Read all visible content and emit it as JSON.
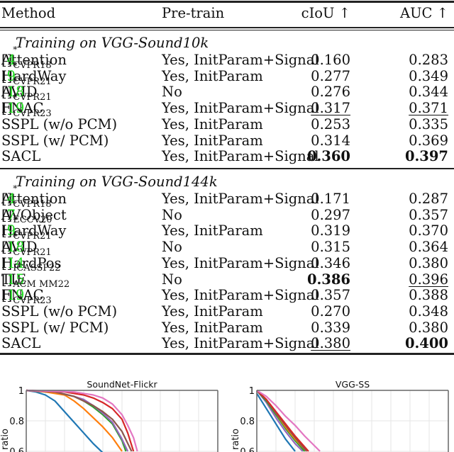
{
  "table": {
    "headers": {
      "method": "Method",
      "pretrain": "Pre-train",
      "ciou": "cIoU ↑",
      "auc": "AUC ↑"
    },
    "sections": [
      {
        "title": "Training on VGG-Sound10k",
        "rows": [
          {
            "name": "Attention",
            "ref": "4",
            "star": "*",
            "venue": "CVPR18",
            "pretrain": "Yes, InitParam+Signal",
            "ciou": "0.160",
            "auc": "0.283",
            "ciou_style": "",
            "auc_style": ""
          },
          {
            "name": "HardWay",
            "ref": "9",
            "star": "*",
            "venue": "CVPR21",
            "pretrain": "Yes, InitParam",
            "ciou": "0.277",
            "auc": "0.349",
            "ciou_style": "",
            "auc_style": ""
          },
          {
            "name": "AVID",
            "ref": "18",
            "star": "*",
            "venue": "CVPR21",
            "pretrain": "No",
            "ciou": "0.276",
            "auc": "0.344",
            "ciou_style": "",
            "auc_style": ""
          },
          {
            "name": "FNAC",
            "ref": "19",
            "star": "*",
            "venue": "CVPR23",
            "pretrain": "Yes, InitParam+Signal",
            "ciou": "0.317",
            "auc": "0.371",
            "ciou_style": "underline",
            "auc_style": "underline"
          },
          {
            "name": "SSPL (w/o PCM)",
            "ref": "",
            "star": "",
            "venue": "",
            "pretrain": "Yes, InitParam",
            "ciou": "0.253",
            "auc": "0.335",
            "ciou_style": "",
            "auc_style": ""
          },
          {
            "name": "SSPL (w/ PCM)",
            "ref": "",
            "star": "",
            "venue": "",
            "pretrain": "Yes, InitParam",
            "ciou": "0.314",
            "auc": "0.369",
            "ciou_style": "",
            "auc_style": ""
          },
          {
            "name": "SACL",
            "ref": "",
            "star": "",
            "venue": "",
            "pretrain": "Yes, InitParam+Signal",
            "ciou": "0.360",
            "auc": "0.397",
            "ciou_style": "bold",
            "auc_style": "bold"
          }
        ]
      },
      {
        "title": "Training on VGG-Sound144k",
        "rows": [
          {
            "name": "Attention",
            "ref": "4",
            "star": "*",
            "venue": "CVPR18",
            "pretrain": "Yes, InitParam+Signal",
            "ciou": "0.171",
            "auc": "0.287",
            "ciou_style": "",
            "auc_style": ""
          },
          {
            "name": "AVObject",
            "ref": "7",
            "star": "",
            "venue": "ECCV20",
            "pretrain": "No",
            "ciou": "0.297",
            "auc": "0.357",
            "ciou_style": "",
            "auc_style": ""
          },
          {
            "name": "HardWay",
            "ref": "9",
            "star": "*",
            "venue": "CVPR21",
            "pretrain": "Yes, InitParam",
            "ciou": "0.319",
            "auc": "0.370",
            "ciou_style": "",
            "auc_style": ""
          },
          {
            "name": "AVID",
            "ref": "18",
            "star": "*",
            "venue": "CVPR21",
            "pretrain": "No",
            "ciou": "0.315",
            "auc": "0.364",
            "ciou_style": "",
            "auc_style": ""
          },
          {
            "name": "HardPos",
            "ref": "14",
            "star": "",
            "venue": "ICASSP22",
            "pretrain": "Yes, InitParam+Signal",
            "ciou": "0.346",
            "auc": "0.380",
            "ciou_style": "",
            "auc_style": ""
          },
          {
            "name": "TIE",
            "ref": "15",
            "star": "",
            "venue": "ACM MM22",
            "pretrain": "No",
            "ciou": "0.386",
            "auc": "0.396",
            "ciou_style": "bold",
            "auc_style": "underline"
          },
          {
            "name": "FNAC",
            "ref": "19",
            "star": "*",
            "venue": "CVPR23",
            "pretrain": "Yes, InitParam+Signal",
            "ciou": "0.357",
            "auc": "0.388",
            "ciou_style": "",
            "auc_style": ""
          },
          {
            "name": "SSPL (w/o PCM)",
            "ref": "",
            "star": "",
            "venue": "",
            "pretrain": "Yes, InitParam",
            "ciou": "0.270",
            "auc": "0.348",
            "ciou_style": "",
            "auc_style": ""
          },
          {
            "name": "SSPL (w/ PCM)",
            "ref": "",
            "star": "",
            "venue": "",
            "pretrain": "Yes, InitParam",
            "ciou": "0.339",
            "auc": "0.380",
            "ciou_style": "",
            "auc_style": ""
          },
          {
            "name": "SACL",
            "ref": "",
            "star": "",
            "venue": "",
            "pretrain": "Yes, InitParam+Signal",
            "ciou": "0.380",
            "auc": "0.400",
            "ciou_style": "underline",
            "auc_style": "bold"
          }
        ]
      }
    ]
  },
  "chart_data": [
    {
      "type": "line",
      "title": "SoundNet-Flickr",
      "ylabel": "ratio",
      "xlabel": "",
      "yticks": [
        "1",
        "0.8",
        "0.6"
      ],
      "ylim_visible": [
        0.6,
        1.0
      ],
      "xlim": [
        0,
        1
      ],
      "grid": true,
      "series": [
        {
          "name": "blue",
          "color": "#1f77b4",
          "x": [
            0,
            0.05,
            0.1,
            0.15,
            0.2,
            0.25,
            0.3,
            0.35,
            0.4
          ],
          "y": [
            1,
            0.99,
            0.97,
            0.93,
            0.86,
            0.79,
            0.72,
            0.65,
            0.59
          ]
        },
        {
          "name": "orange",
          "color": "#ff7f0e",
          "x": [
            0,
            0.1,
            0.2,
            0.25,
            0.3,
            0.35,
            0.4,
            0.45,
            0.5
          ],
          "y": [
            1,
            0.99,
            0.97,
            0.93,
            0.88,
            0.82,
            0.76,
            0.69,
            0.6
          ]
        },
        {
          "name": "green",
          "color": "#2ca02c",
          "x": [
            0,
            0.15,
            0.25,
            0.3,
            0.35,
            0.4,
            0.45,
            0.5,
            0.52
          ],
          "y": [
            1,
            0.99,
            0.96,
            0.93,
            0.89,
            0.84,
            0.78,
            0.67,
            0.6
          ]
        },
        {
          "name": "purple",
          "color": "#9467bd",
          "x": [
            0,
            0.15,
            0.25,
            0.3,
            0.35,
            0.4,
            0.45,
            0.5,
            0.53
          ],
          "y": [
            1,
            0.99,
            0.96,
            0.94,
            0.9,
            0.85,
            0.79,
            0.68,
            0.6
          ]
        },
        {
          "name": "brown",
          "color": "#8c564b",
          "x": [
            0,
            0.15,
            0.25,
            0.3,
            0.35,
            0.4,
            0.45,
            0.5,
            0.55
          ],
          "y": [
            1,
            0.99,
            0.96,
            0.93,
            0.9,
            0.86,
            0.81,
            0.73,
            0.6
          ]
        },
        {
          "name": "red",
          "color": "#d62728",
          "x": [
            0,
            0.2,
            0.3,
            0.35,
            0.4,
            0.45,
            0.5,
            0.53,
            0.56
          ],
          "y": [
            1,
            0.99,
            0.97,
            0.95,
            0.92,
            0.88,
            0.81,
            0.72,
            0.6
          ]
        },
        {
          "name": "pink",
          "color": "#e377c2",
          "x": [
            0,
            0.25,
            0.35,
            0.4,
            0.45,
            0.5,
            0.53,
            0.56,
            0.58
          ],
          "y": [
            1,
            0.99,
            0.97,
            0.95,
            0.91,
            0.84,
            0.77,
            0.69,
            0.6
          ]
        }
      ]
    },
    {
      "type": "line",
      "title": "VGG-SS",
      "ylabel": "ratio",
      "xlabel": "",
      "yticks": [
        "1",
        "0.8",
        "0.6"
      ],
      "ylim_visible": [
        0.6,
        1.0
      ],
      "xlim": [
        0,
        1
      ],
      "grid": true,
      "series": [
        {
          "name": "blue",
          "color": "#1f77b4",
          "x": [
            0,
            0.05,
            0.1,
            0.15,
            0.2
          ],
          "y": [
            0.98,
            0.88,
            0.78,
            0.68,
            0.6
          ]
        },
        {
          "name": "purple",
          "color": "#9467bd",
          "x": [
            0,
            0.05,
            0.1,
            0.15,
            0.2,
            0.24
          ],
          "y": [
            1,
            0.92,
            0.82,
            0.73,
            0.65,
            0.6
          ]
        },
        {
          "name": "green",
          "color": "#2ca02c",
          "x": [
            0,
            0.05,
            0.1,
            0.15,
            0.2,
            0.25
          ],
          "y": [
            1,
            0.93,
            0.84,
            0.75,
            0.67,
            0.6
          ]
        },
        {
          "name": "orange",
          "color": "#ff7f0e",
          "x": [
            0,
            0.05,
            0.1,
            0.15,
            0.2,
            0.26
          ],
          "y": [
            1,
            0.94,
            0.85,
            0.76,
            0.68,
            0.6
          ]
        },
        {
          "name": "brown",
          "color": "#8c564b",
          "x": [
            0,
            0.05,
            0.1,
            0.15,
            0.2,
            0.26
          ],
          "y": [
            1,
            0.94,
            0.85,
            0.77,
            0.69,
            0.6
          ]
        },
        {
          "name": "red",
          "color": "#d62728",
          "x": [
            0,
            0.05,
            0.1,
            0.15,
            0.2,
            0.27
          ],
          "y": [
            1,
            0.94,
            0.86,
            0.78,
            0.7,
            0.6
          ]
        },
        {
          "name": "pink",
          "color": "#e377c2",
          "x": [
            0,
            0.05,
            0.1,
            0.15,
            0.2,
            0.25,
            0.33
          ],
          "y": [
            1,
            0.96,
            0.9,
            0.83,
            0.77,
            0.7,
            0.6
          ]
        }
      ]
    }
  ]
}
